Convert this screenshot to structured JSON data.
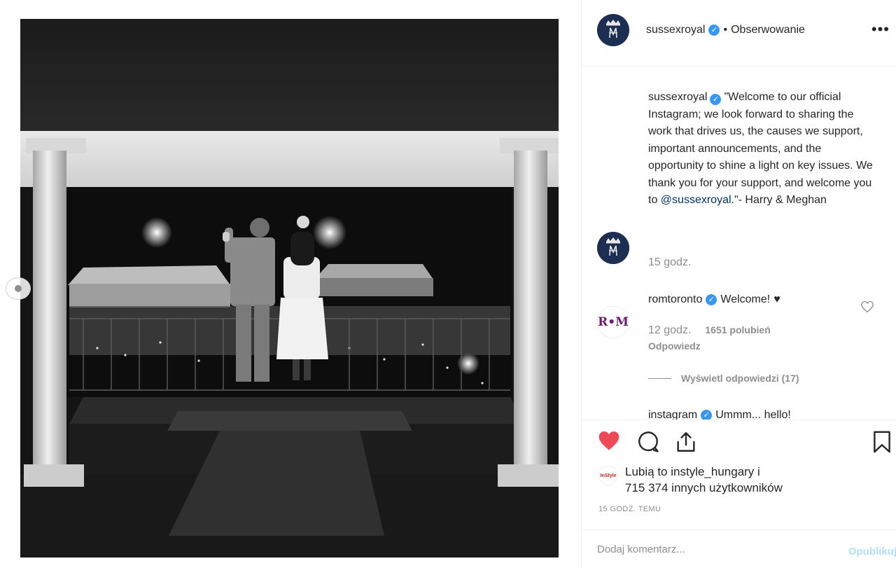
{
  "post": {
    "image_alt": "Harry & Meghan on balcony at night"
  },
  "header": {
    "username": "sussexroyal",
    "verified_icon": "verified-badge-icon",
    "separator": "•",
    "follow_status": "Obserwowanie",
    "more_label": "•••"
  },
  "caption": {
    "username": "sussexroyal",
    "text_before": "\"Welcome to our official Instagram; we look forward to sharing the work that drives us, the causes we support, important announcements, and the opportunity to shine a light on key issues. We thank you for your support, and welcome you to ",
    "mention": "@sussexroyal",
    "text_after": ".\"- Harry & Meghan",
    "time": "15 godz."
  },
  "comments": [
    {
      "avatar_text": "R•M",
      "username": "romtoronto",
      "text": "Welcome!",
      "emoji": "♥",
      "time": "12 godz.",
      "likes": "1651 polubień",
      "reply_label": "Odpowiedz",
      "view_replies": "Wyświetl odpowiedzi (17)"
    },
    {
      "username": "instagram",
      "text": "Ummm... hello!"
    }
  ],
  "actions": {
    "like_color": "#ed4956",
    "like_icon": "heart-filled-icon",
    "comment_icon": "comment-bubble-icon",
    "share_icon": "share-icon",
    "save_icon": "bookmark-icon"
  },
  "likes": {
    "liker_avatar": "InStyle",
    "prefix": "Lubią to ",
    "liker": "instyle_hungary",
    "middle": " i",
    "count_text": "715 374 innych użytkowników"
  },
  "timestamp": "15 GODZ. TEMU",
  "comment_input": {
    "placeholder": "Dodaj komentarz...",
    "publish_label": "Opublikuj"
  }
}
